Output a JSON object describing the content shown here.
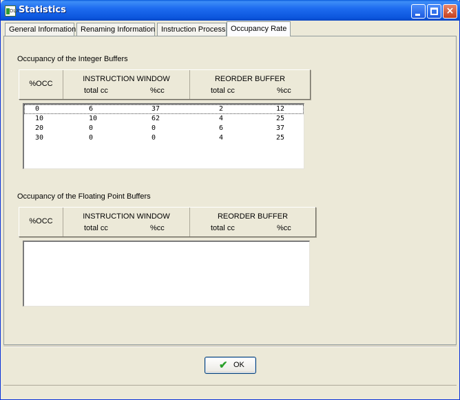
{
  "window": {
    "title": "Statistics",
    "icon_text": "DLX",
    "buttons": {
      "minimize": "minimize-icon",
      "maximize": "maximize-icon",
      "close": "×"
    }
  },
  "tabs": [
    {
      "label": "General Information",
      "active": false
    },
    {
      "label": "Renaming Information",
      "active": false
    },
    {
      "label": "Instruction Process",
      "active": false
    },
    {
      "label": "Occupancy Rate",
      "active": true
    }
  ],
  "integer_section": {
    "title": "Occupancy of the Integer Buffers",
    "header": {
      "occ": "%OCC",
      "instruction_window": "INSTRUCTION WINDOW",
      "reorder_buffer": "REORDER BUFFER",
      "total_cc": "total cc",
      "pct_cc": "%cc"
    },
    "rows": [
      {
        "occ": "0",
        "iw_total": "6",
        "iw_pct": "37",
        "rb_total": "2",
        "rb_pct": "12"
      },
      {
        "occ": "10",
        "iw_total": "10",
        "iw_pct": "62",
        "rb_total": "4",
        "rb_pct": "25"
      },
      {
        "occ": "20",
        "iw_total": "0",
        "iw_pct": "0",
        "rb_total": "6",
        "rb_pct": "37"
      },
      {
        "occ": "30",
        "iw_total": "0",
        "iw_pct": "0",
        "rb_total": "4",
        "rb_pct": "25"
      }
    ]
  },
  "fp_section": {
    "title": "Occupancy of the Floating Point Buffers",
    "header": {
      "occ": "%OCC",
      "instruction_window": "INSTRUCTION WINDOW",
      "reorder_buffer": "REORDER BUFFER",
      "total_cc": "total cc",
      "pct_cc": "%cc"
    },
    "rows": []
  },
  "footer": {
    "ok_label": "OK"
  },
  "colors": {
    "titlebar": "#0b55dc",
    "window_bg": "#ece9d8",
    "ok_check": "#2aa02a"
  }
}
